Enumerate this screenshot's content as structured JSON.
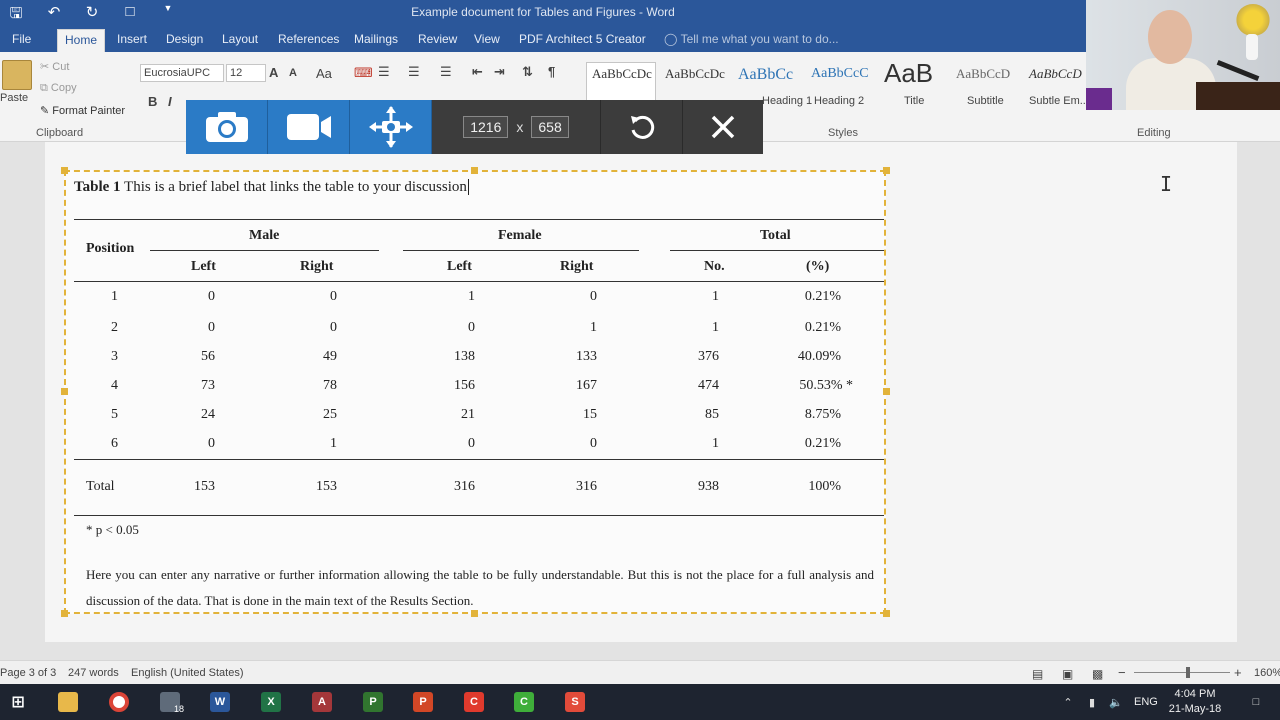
{
  "window": {
    "title": "Example document for Tables and Figures - Word"
  },
  "ribbon": {
    "tabs": [
      "File",
      "Home",
      "Insert",
      "Design",
      "Layout",
      "References",
      "Mailings",
      "Review",
      "View",
      "PDF Architect 5 Creator"
    ],
    "active_tab": "Home",
    "tell_me": "Tell me what you want to do...",
    "clipboard": {
      "paste": "Paste",
      "cut": "Cut",
      "copy": "Copy",
      "format_painter": "Format Painter",
      "group": "Clipboard"
    },
    "font": {
      "name": "EucrosiaUPC",
      "size": "12"
    },
    "styles": {
      "group": "Styles",
      "items": [
        {
          "swatch": "AaBbCcDc",
          "name": ""
        },
        {
          "swatch": "AaBbCcDc",
          "name": ""
        },
        {
          "swatch": "AaBbCc",
          "name": "Heading 1"
        },
        {
          "swatch": "AaBbCcC",
          "name": "Heading 2"
        },
        {
          "swatch": "AaB",
          "name": "Title"
        },
        {
          "swatch": "AaBbCcD",
          "name": "Subtitle"
        },
        {
          "swatch": "AaBbCcD",
          "name": "Subtle Em..."
        }
      ]
    },
    "editing_group": "Editing"
  },
  "capture_toolbar": {
    "width": "1216",
    "times": "x",
    "height": "658"
  },
  "table": {
    "caption_bold": "Table 1",
    "caption_text": "This is a brief label that links the table to your discussion",
    "headers": {
      "position": "Position",
      "male": "Male",
      "female": "Female",
      "total": "Total",
      "left": "Left",
      "right": "Right",
      "no": "No.",
      "pct": "(%)"
    },
    "rows": [
      [
        "1",
        "0",
        "0",
        "1",
        "0",
        "1",
        "0.21%"
      ],
      [
        "2",
        "0",
        "0",
        "0",
        "1",
        "1",
        "0.21%"
      ],
      [
        "3",
        "56",
        "49",
        "138",
        "133",
        "376",
        "40.09%"
      ],
      [
        "4",
        "73",
        "78",
        "156",
        "167",
        "474",
        "50.53% *"
      ],
      [
        "5",
        "24",
        "25",
        "21",
        "15",
        "85",
        "8.75%"
      ],
      [
        "6",
        "0",
        "1",
        "0",
        "0",
        "1",
        "0.21%"
      ]
    ],
    "total_row": [
      "Total",
      "153",
      "153",
      "316",
      "316",
      "938",
      "100%"
    ],
    "footnote": "* p < 0.05",
    "narrative": "Here you can enter any narrative or further information allowing the table to be fully understandable. But this is not the place for a full analysis and discussion of the data. That is done in the main text of the Results Section."
  },
  "status_bar": {
    "page": "Page 3 of 3",
    "words": "247 words",
    "language": "English (United States)",
    "zoom": "160%"
  },
  "taskbar": {
    "lang": "ENG",
    "time": "4:04 PM",
    "date": "21-May-18",
    "mail_badge": "18"
  }
}
